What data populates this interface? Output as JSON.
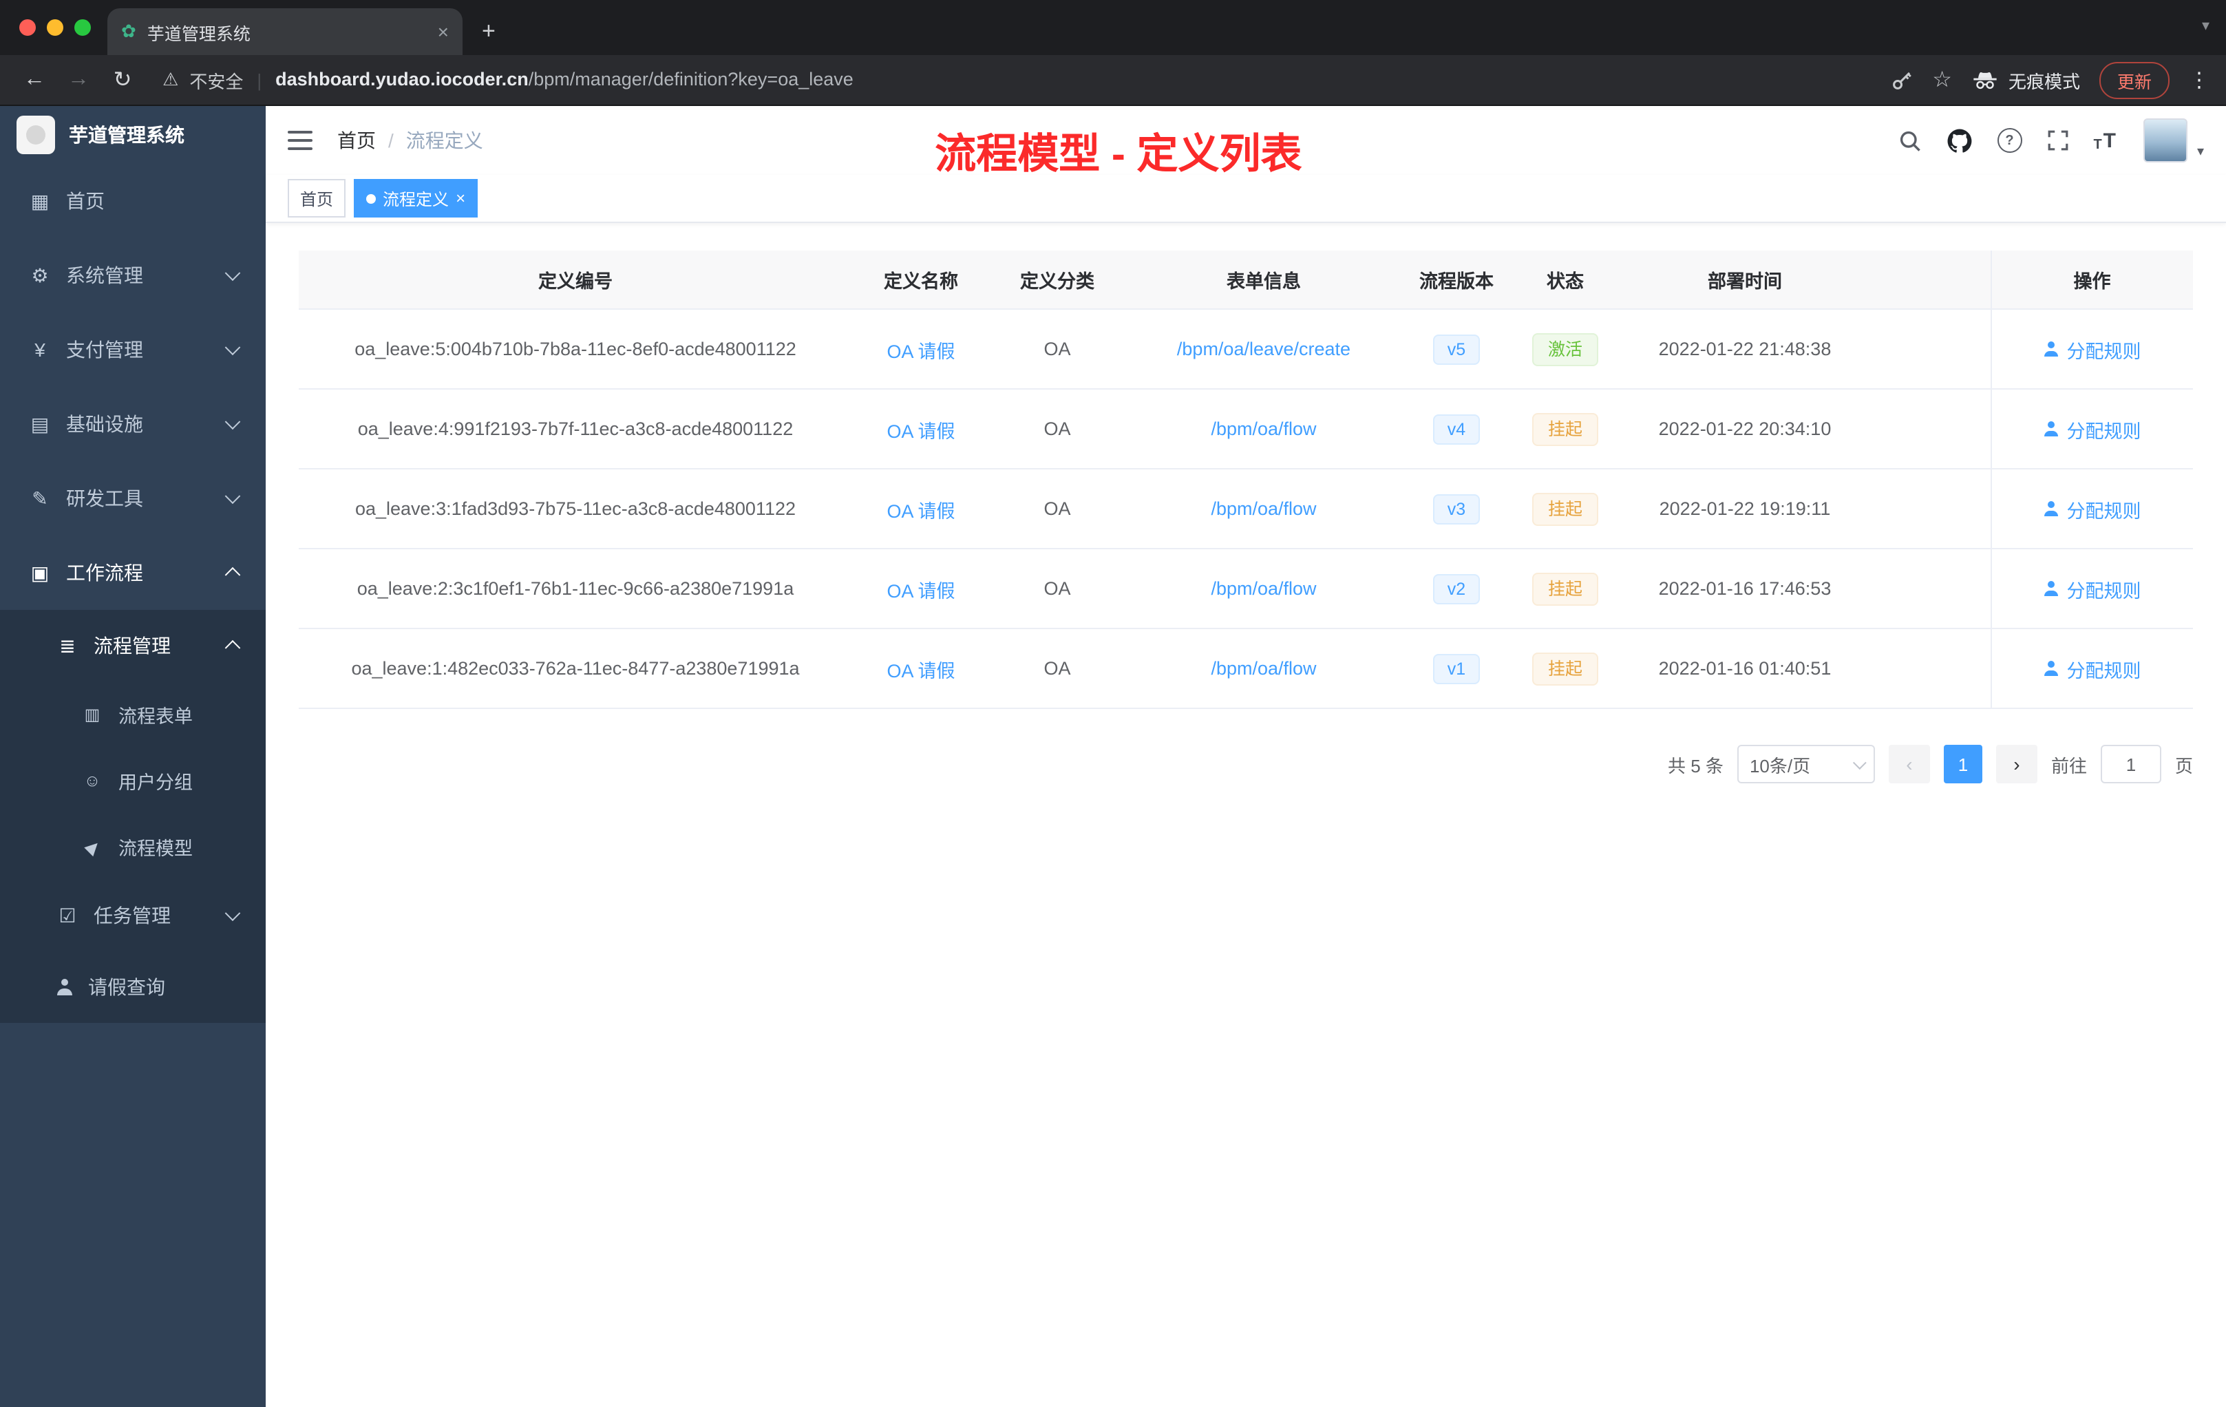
{
  "colors": {
    "accent": "#409EFF",
    "success": "#67C23A",
    "warning": "#E6A23C",
    "sidebar_bg": "#304156",
    "submenu_bg": "#263445",
    "overlay_red": "#FB2A2A"
  },
  "icons": {
    "favicon": "✿",
    "close": "×",
    "plus": "+",
    "caret_down": "▾",
    "back": "←",
    "forward": "→",
    "reload": "↻",
    "warning": "⚠",
    "divider": "|",
    "star": "☆",
    "menu_dots": "⋮",
    "question": "?",
    "font_t": "T",
    "prev": "‹",
    "next": "›",
    "home": "▦",
    "gear": "⚙",
    "yen": "¥",
    "infra": "▤",
    "tools": "✎",
    "briefcase": "▣",
    "list": "≣",
    "doc": "▥",
    "chat": "☺",
    "plane": "▶",
    "task": "☑",
    "person": ""
  },
  "browser": {
    "tab_title": "芋道管理系统",
    "security_label": "不安全",
    "url_domain": "dashboard.yudao.iocoder.cn",
    "url_path": "/bpm/manager/definition?key=oa_leave",
    "incognito_label": "无痕模式",
    "update_label": "更新"
  },
  "sidebar": {
    "logo_title": "芋道管理系统",
    "items": [
      {
        "key": "home",
        "label": "首页",
        "icon": "home",
        "level": 1
      },
      {
        "key": "system-mgmt",
        "label": "系统管理",
        "icon": "gear",
        "level": 1,
        "chevron": "down"
      },
      {
        "key": "payment-mgmt",
        "label": "支付管理",
        "icon": "yen",
        "level": 1,
        "chevron": "down"
      },
      {
        "key": "infrastructure",
        "label": "基础设施",
        "icon": "infra",
        "level": 1,
        "chevron": "down"
      },
      {
        "key": "dev-tools",
        "label": "研发工具",
        "icon": "tools",
        "level": 1,
        "chevron": "down"
      },
      {
        "key": "workflow",
        "label": "工作流程",
        "icon": "briefcase",
        "level": 1,
        "chevron": "up",
        "bright": true
      },
      {
        "key": "process-mgmt",
        "label": "流程管理",
        "icon": "list",
        "level": 2,
        "chevron": "up",
        "bright": true,
        "dark": true
      },
      {
        "key": "process-form",
        "label": "流程表单",
        "icon": "doc",
        "level": 3,
        "dark": true
      },
      {
        "key": "user-group",
        "label": "用户分组",
        "icon": "chat",
        "level": 3,
        "dark": true
      },
      {
        "key": "process-model",
        "label": "流程模型",
        "icon": "plane",
        "level": 3,
        "dark": true
      },
      {
        "key": "task-mgmt",
        "label": "任务管理",
        "icon": "task",
        "level": 2,
        "chevron": "down",
        "dark": true
      },
      {
        "key": "leave-query",
        "label": "请假查询",
        "icon": "person",
        "level": 2,
        "dark": true
      }
    ]
  },
  "header": {
    "breadcrumb_home": "首页",
    "breadcrumb_sep": "/",
    "breadcrumb_current": "流程定义",
    "overlay_title": "流程模型 - 定义列表"
  },
  "tags": [
    {
      "label": "首页",
      "active": false
    },
    {
      "label": "流程定义",
      "active": true
    }
  ],
  "table": {
    "columns": [
      "定义编号",
      "定义名称",
      "定义分类",
      "表单信息",
      "流程版本",
      "状态",
      "部署时间",
      "操作"
    ],
    "rows": [
      {
        "id": "oa_leave:5:004b710b-7b8a-11ec-8ef0-acde48001122",
        "name": "OA 请假",
        "category": "OA",
        "form": "/bpm/oa/leave/create",
        "version": "v5",
        "status": "激活",
        "status_type": "success",
        "deploy_time": "2022-01-22 21:48:38",
        "action": "分配规则"
      },
      {
        "id": "oa_leave:4:991f2193-7b7f-11ec-a3c8-acde48001122",
        "name": "OA 请假",
        "category": "OA",
        "form": "/bpm/oa/flow",
        "version": "v4",
        "status": "挂起",
        "status_type": "warning",
        "deploy_time": "2022-01-22 20:34:10",
        "action": "分配规则"
      },
      {
        "id": "oa_leave:3:1fad3d93-7b75-11ec-a3c8-acde48001122",
        "name": "OA 请假",
        "category": "OA",
        "form": "/bpm/oa/flow",
        "version": "v3",
        "status": "挂起",
        "status_type": "warning",
        "deploy_time": "2022-01-22 19:19:11",
        "action": "分配规则"
      },
      {
        "id": "oa_leave:2:3c1f0ef1-76b1-11ec-9c66-a2380e71991a",
        "name": "OA 请假",
        "category": "OA",
        "form": "/bpm/oa/flow",
        "version": "v2",
        "status": "挂起",
        "status_type": "warning",
        "deploy_time": "2022-01-16 17:46:53",
        "action": "分配规则"
      },
      {
        "id": "oa_leave:1:482ec033-762a-11ec-8477-a2380e71991a",
        "name": "OA 请假",
        "category": "OA",
        "form": "/bpm/oa/flow",
        "version": "v1",
        "status": "挂起",
        "status_type": "warning",
        "deploy_time": "2022-01-16 01:40:51",
        "action": "分配规则"
      }
    ]
  },
  "pagination": {
    "total": "共 5 条",
    "page_size": "10条/页",
    "page": "1",
    "goto": "前往",
    "unit": "页"
  }
}
